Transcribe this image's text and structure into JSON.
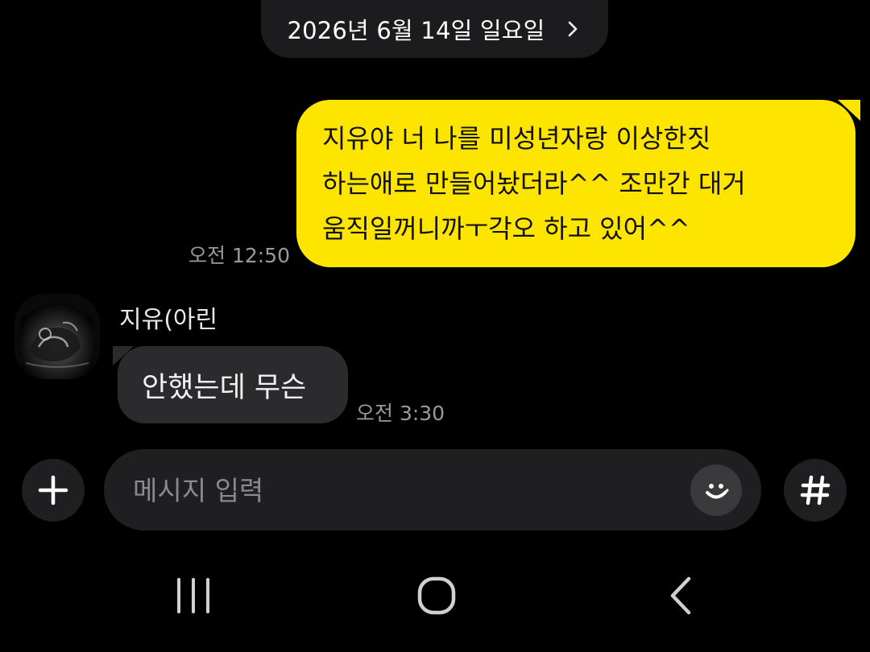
{
  "date_header": {
    "label": "2026년 6월 14일 일요일",
    "chevron_icon": "chevron-right-icon"
  },
  "messages": [
    {
      "direction": "outgoing",
      "text": "지유야 너 나를 미성년자랑 이상한짓\n하는애로 만들어놨더라^^ 조만간 대거\n움직일꺼니까ㅜ각오 하고 있어^^",
      "time": "오전 12:50",
      "bubble_color": "#fee500"
    },
    {
      "direction": "incoming",
      "sender": "지유(아린",
      "avatar_icon": "ultrasound-photo-avatar",
      "text": "안했는데 무슨",
      "time": "오전 3:30",
      "bubble_color": "#2b2b2d"
    }
  ],
  "composer": {
    "plus_icon": "plus-icon",
    "placeholder": "메시지 입력",
    "value": "",
    "emoji_icon": "smiley-icon",
    "hash_icon": "hashtag-icon"
  },
  "nav_bar": {
    "recents_icon": "recents-icon",
    "home_icon": "home-icon",
    "back_icon": "back-icon"
  },
  "colors": {
    "background": "#000000",
    "outgoing_bubble": "#fee500",
    "incoming_bubble": "#2b2b2d",
    "pill": "#1c1c1e",
    "timestamp": "#9a9a9a"
  }
}
